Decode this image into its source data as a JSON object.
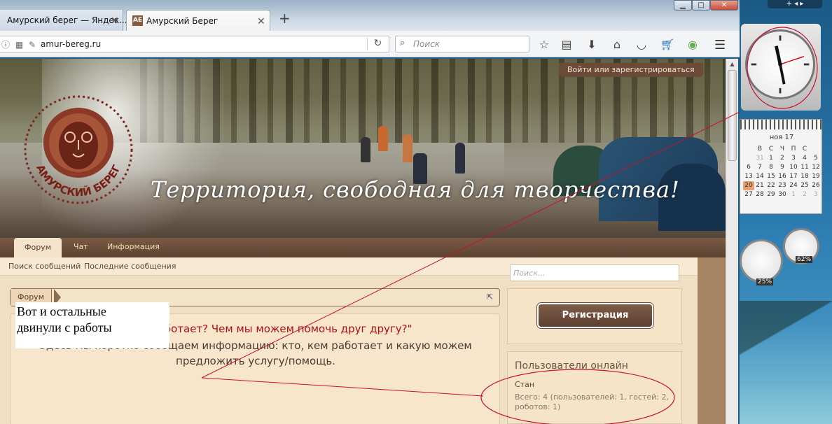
{
  "browser": {
    "tabs": [
      {
        "label": "Амурский берег — Яндек...",
        "close": "✕"
      },
      {
        "label": "Амурский Берег",
        "close": "✕",
        "favicon": "AE"
      }
    ],
    "newtab": "+",
    "url": "amur-bereg.ru",
    "search_placeholder": "Поиск",
    "window_controls": {
      "minimize": "▁",
      "maximize": "□",
      "close": "✕"
    }
  },
  "site": {
    "login_link": "Войти или зарегистрироваться",
    "logo_text": "АМУРСКИЙ БЕРЕГ",
    "slogan": "Территория, свободная для творчества!",
    "nav_tabs": [
      "Форум",
      "Чат",
      "Информация"
    ],
    "sub_nav": [
      "Поиск сообщений",
      "Последние сообщения"
    ],
    "breadcrumb": "Форум",
    "notice": {
      "title": "\"Кто кем работает? Чем мы можем помочь друг другу?\"",
      "text": "Здесь мы коротко сообщаем информацию: кто, кем работает и какую можем предложить услугу/помощь."
    },
    "sidebar": {
      "search_placeholder": "Поиск...",
      "register_button": "Регистрация",
      "online_title": "Пользователи онлайн",
      "online_user": "Стан",
      "online_count": "Всего: 4 (пользователей: 1, гостей: 2, роботов: 1)"
    }
  },
  "annotation": {
    "text_line1": "Вот и остальные",
    "text_line2": "двинули  с работы"
  },
  "desktop": {
    "calendar": {
      "month": "ноя 17",
      "weekdays": [
        "В",
        "С",
        "Ч",
        "П",
        "С"
      ],
      "rows": [
        [
          "31",
          "1",
          "2",
          "3",
          "4",
          "5"
        ],
        [
          "6",
          "7",
          "8",
          "9",
          "10",
          "11",
          "12"
        ],
        [
          "13",
          "14",
          "15",
          "16",
          "17",
          "18",
          "19"
        ],
        [
          "20",
          "21",
          "22",
          "23",
          "24",
          "25",
          "26"
        ],
        [
          "27",
          "28",
          "29",
          "30",
          "1",
          "2",
          "3"
        ]
      ]
    },
    "gauge_cpu": "25%",
    "gauge_mem": "62%"
  },
  "colors": {
    "accent": "#6b4a38",
    "notice_title": "#b01010",
    "annotation": "#c8102e"
  }
}
